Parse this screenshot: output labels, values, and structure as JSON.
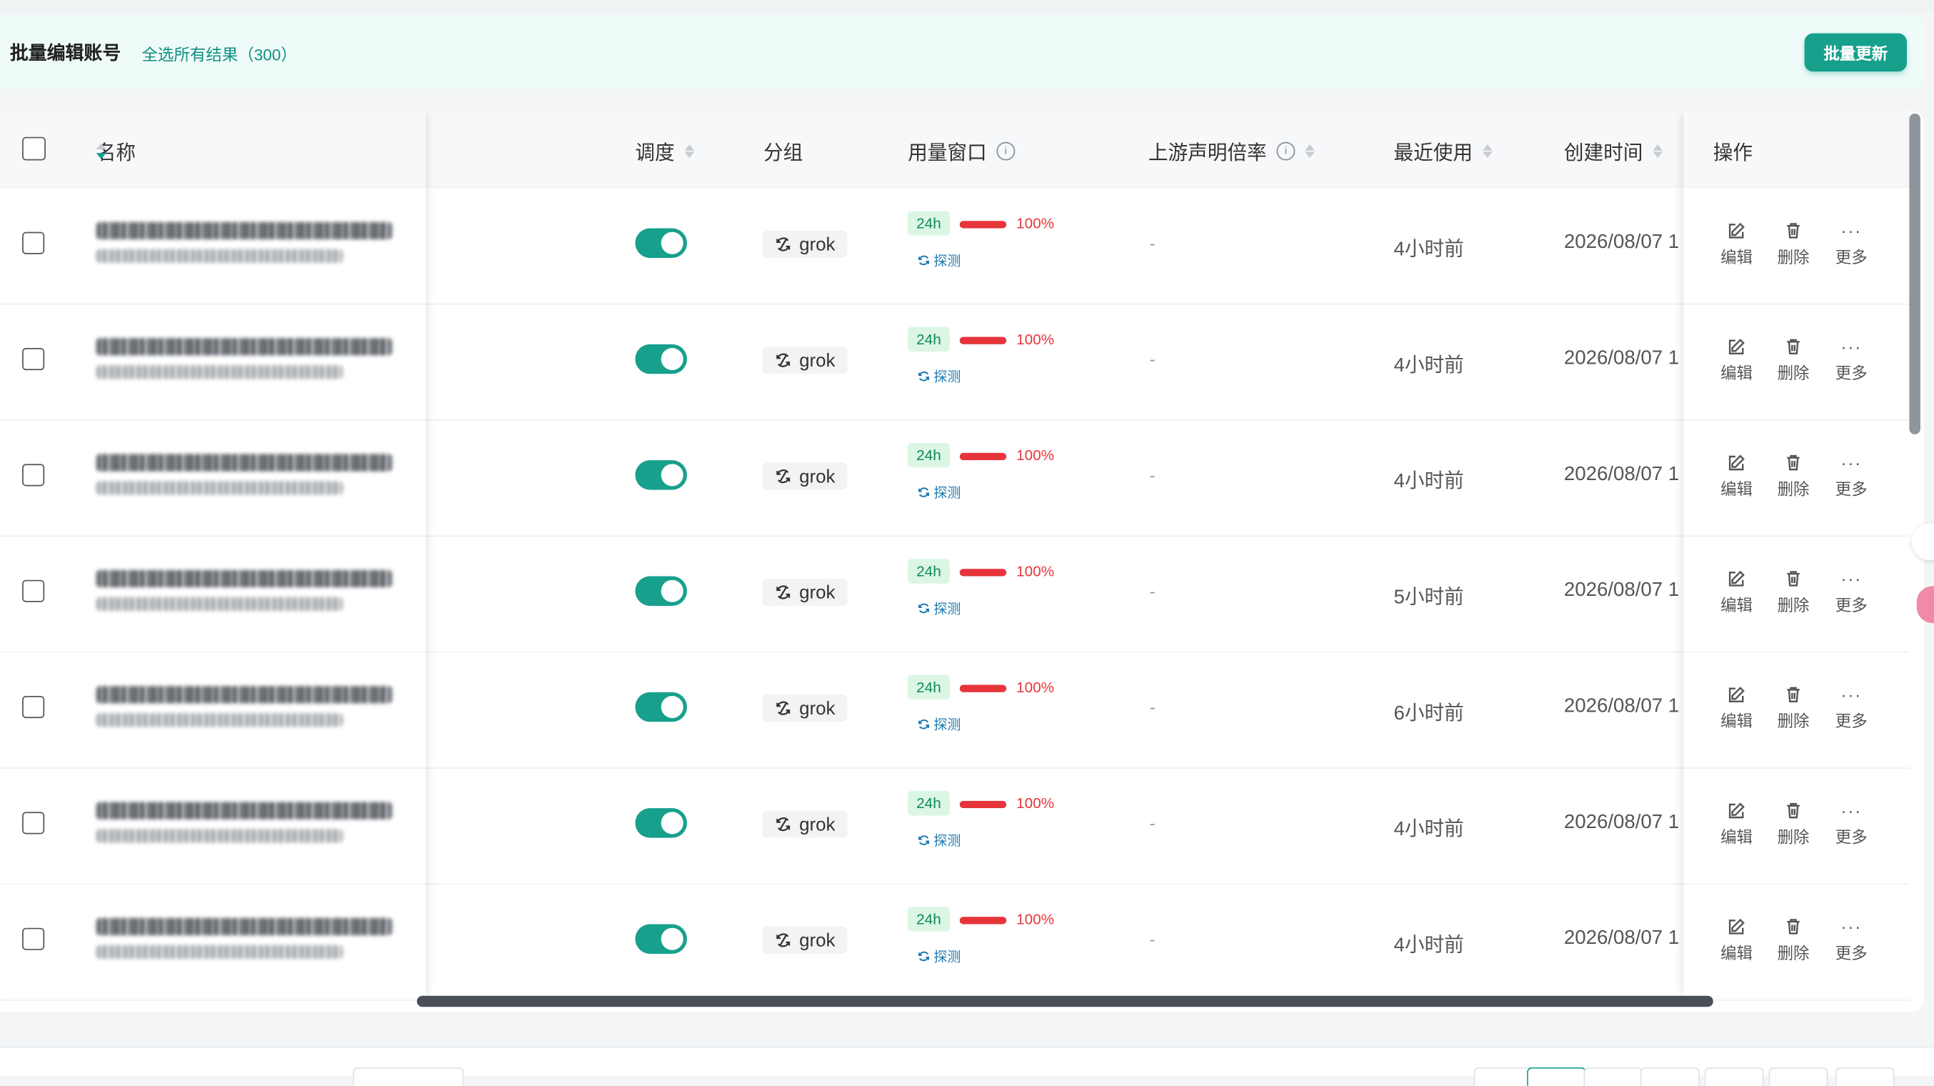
{
  "banner": {
    "title": "批量编辑账号",
    "select_all": "全选所有结果（300）",
    "bulk_update": "批量更新"
  },
  "columns": {
    "name": "名称",
    "schedule": "调度",
    "group": "分组",
    "usage_window": "用量窗口",
    "upstream_ratio": "上游声明倍率",
    "last_used": "最近使用",
    "created": "创建时间",
    "actions": "操作"
  },
  "actions": {
    "edit": "编辑",
    "delete": "删除",
    "more": "更多"
  },
  "rows": [
    {
      "schedule_on": true,
      "group": "grok",
      "window": "24h",
      "usage_pct_text": "100%",
      "usage_fraction": 1.0,
      "probe": "探测",
      "upstream_ratio": "-",
      "last_used": "4小时前",
      "created": "2026/08/07 1"
    },
    {
      "schedule_on": true,
      "group": "grok",
      "window": "24h",
      "usage_pct_text": "100%",
      "usage_fraction": 1.0,
      "probe": "探测",
      "upstream_ratio": "-",
      "last_used": "4小时前",
      "created": "2026/08/07 1"
    },
    {
      "schedule_on": true,
      "group": "grok",
      "window": "24h",
      "usage_pct_text": "100%",
      "usage_fraction": 1.0,
      "probe": "探测",
      "upstream_ratio": "-",
      "last_used": "4小时前",
      "created": "2026/08/07 1"
    },
    {
      "schedule_on": true,
      "group": "grok",
      "window": "24h",
      "usage_pct_text": "100%",
      "usage_fraction": 1.0,
      "probe": "探测",
      "upstream_ratio": "-",
      "last_used": "5小时前",
      "created": "2026/08/07 1"
    },
    {
      "schedule_on": true,
      "group": "grok",
      "window": "24h",
      "usage_pct_text": "100%",
      "usage_fraction": 1.0,
      "probe": "探测",
      "upstream_ratio": "-",
      "last_used": "6小时前",
      "created": "2026/08/07 1"
    },
    {
      "schedule_on": true,
      "group": "grok",
      "window": "24h",
      "usage_pct_text": "100%",
      "usage_fraction": 1.0,
      "probe": "探测",
      "upstream_ratio": "-",
      "last_used": "4小时前",
      "created": "2026/08/07 1"
    },
    {
      "schedule_on": true,
      "group": "grok",
      "window": "24h",
      "usage_pct_text": "100%",
      "usage_fraction": 1.0,
      "probe": "探测",
      "upstream_ratio": "-",
      "last_used": "4小时前",
      "created": "2026/08/07 1"
    }
  ],
  "colors": {
    "accent": "#17a08c",
    "danger": "#e5353b",
    "tag_bg": "#dcf6e4",
    "probe": "#1e7bb0"
  },
  "icons": {
    "group": "refresh-slash-icon",
    "edit": "edit-icon",
    "delete": "trash-icon",
    "more": "ellipsis-icon",
    "info": "info-icon",
    "probe": "refresh-icon"
  }
}
